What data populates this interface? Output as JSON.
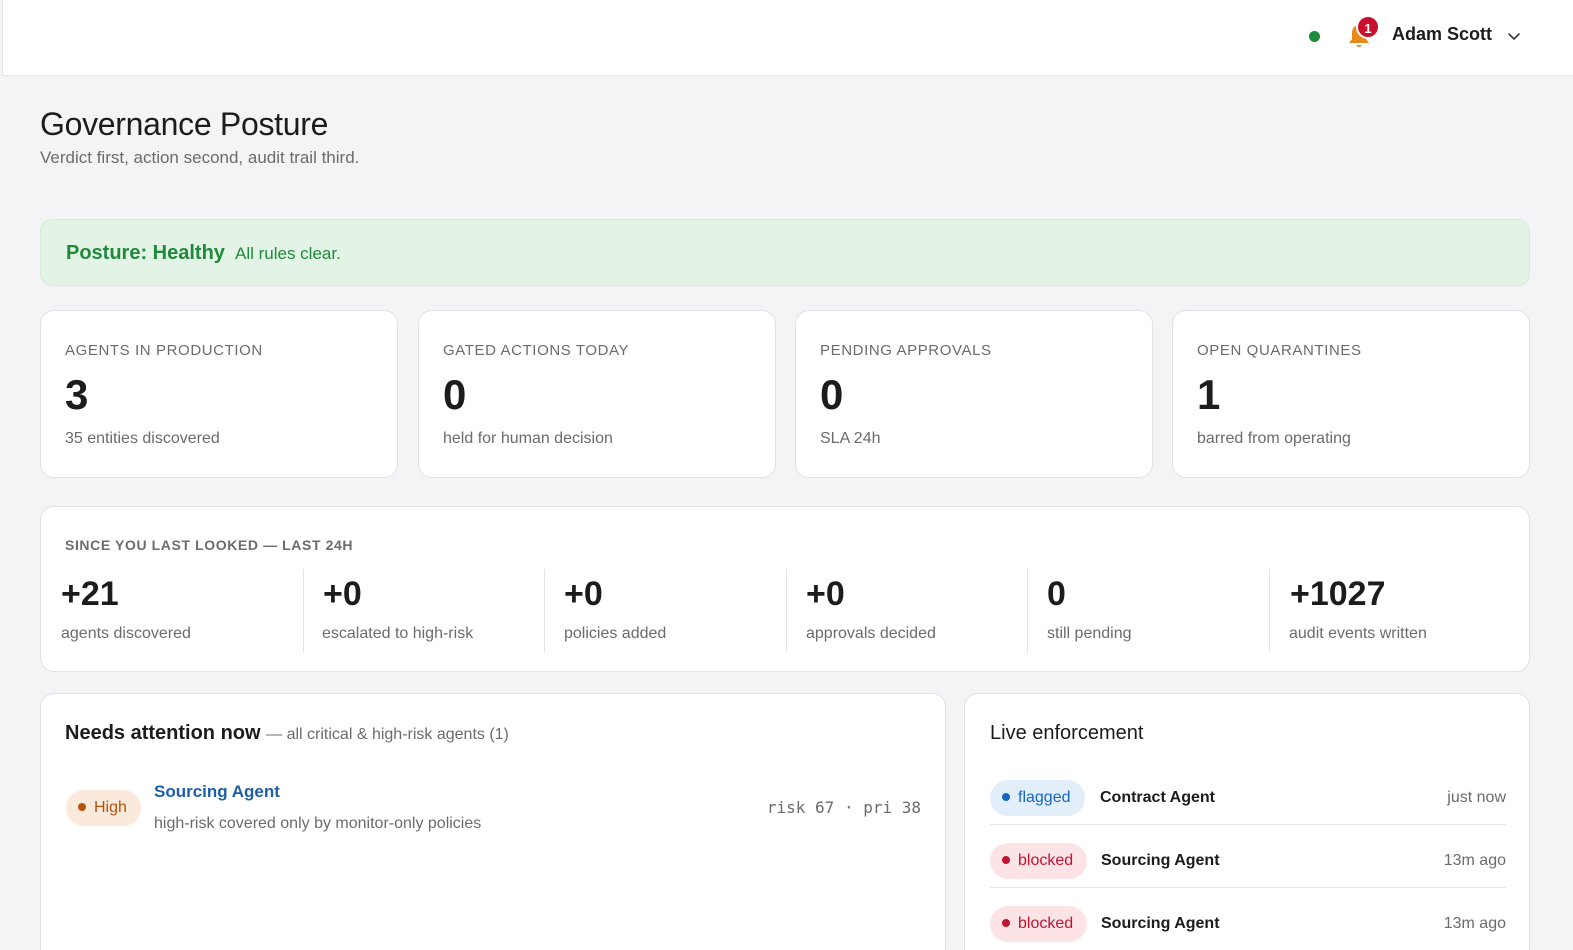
{
  "header": {
    "user_name": "Adam Scott",
    "notification_count": "1",
    "status_color": "#1f8a3b"
  },
  "page": {
    "title": "Governance Posture",
    "subtitle": "Verdict first, action second, audit trail third."
  },
  "posture": {
    "title": "Posture: Healthy",
    "message": "All rules clear."
  },
  "kpis": [
    {
      "label": "AGENTS IN PRODUCTION",
      "value": "3",
      "sub": "35 entities discovered"
    },
    {
      "label": "GATED ACTIONS TODAY",
      "value": "0",
      "sub": "held for human decision"
    },
    {
      "label": "PENDING APPROVALS",
      "value": "0",
      "sub": "SLA 24h"
    },
    {
      "label": "OPEN QUARANTINES",
      "value": "1",
      "sub": "barred from operating"
    }
  ],
  "since": {
    "title": "SINCE YOU LAST LOOKED — LAST 24H",
    "stats": [
      {
        "value": "+21",
        "label": "agents discovered"
      },
      {
        "value": "+0",
        "label": "escalated to high-risk"
      },
      {
        "value": "+0",
        "label": "policies added"
      },
      {
        "value": "+0",
        "label": "approvals decided"
      },
      {
        "value": "0",
        "label": "still pending"
      },
      {
        "value": "+1027",
        "label": "audit events written"
      }
    ]
  },
  "attention": {
    "title": "Needs attention now",
    "subtitle": "— all critical & high-risk agents (1)",
    "items": [
      {
        "severity": "High",
        "agent": "Sourcing Agent",
        "description": "high-risk covered only by monitor-only policies",
        "meta": "risk 67 · pri 38"
      }
    ]
  },
  "live": {
    "title": "Live enforcement",
    "events": [
      {
        "status": "flagged",
        "agent": "Contract Agent",
        "time": "just now"
      },
      {
        "status": "blocked",
        "agent": "Sourcing Agent",
        "time": "13m ago"
      },
      {
        "status": "blocked",
        "agent": "Sourcing Agent",
        "time": "13m ago"
      }
    ]
  }
}
